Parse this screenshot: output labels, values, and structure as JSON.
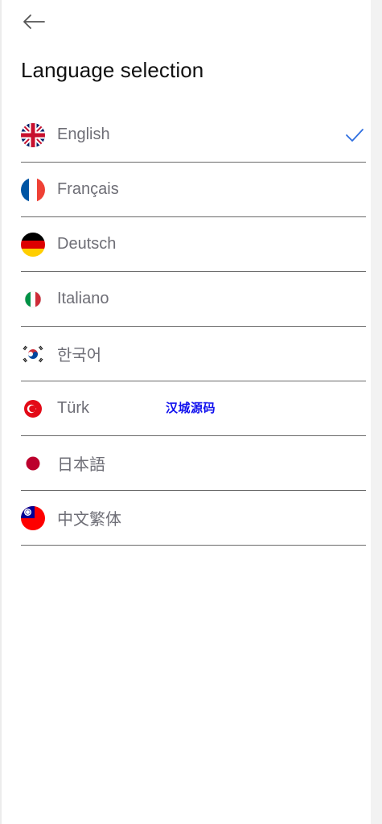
{
  "header": {
    "back_icon": "arrow-left-icon",
    "title": "Language selection"
  },
  "languages": [
    {
      "label": "English",
      "flag": "uk-flag-icon",
      "selected": true
    },
    {
      "label": "Français",
      "flag": "france-flag-icon",
      "selected": false
    },
    {
      "label": "Deutsch",
      "flag": "germany-flag-icon",
      "selected": false
    },
    {
      "label": "Italiano",
      "flag": "italy-flag-icon",
      "selected": false
    },
    {
      "label": "한국어",
      "flag": "korea-flag-icon",
      "selected": false
    },
    {
      "label": "Türk",
      "flag": "turkey-flag-icon",
      "selected": false
    },
    {
      "label": "日本語",
      "flag": "japan-flag-icon",
      "selected": false
    },
    {
      "label": "中文繁体",
      "flag": "taiwan-flag-icon",
      "selected": false
    }
  ],
  "selected_icon": "checkmark-icon",
  "watermark": "汉城源码",
  "colors": {
    "accent": "#2f6fe0",
    "label": "#6e6e76",
    "divider": "#6a6a6a"
  }
}
